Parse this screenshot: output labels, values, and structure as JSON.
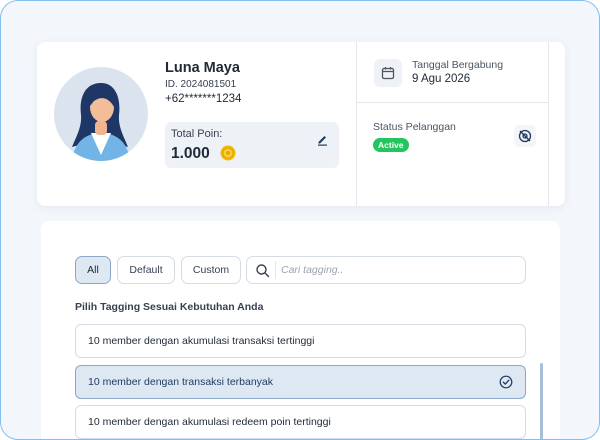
{
  "profile": {
    "name": "Luna Maya",
    "member_id": "ID. 2024081501",
    "phone": "+62*******1234",
    "points_label": "Total Poin:",
    "points_value": "1.000",
    "join_label": "Tanggal Bergabung",
    "join_date": "9 Agu 2026",
    "status_label": "Status Pelanggan",
    "status_badge": "Active"
  },
  "tagging": {
    "filters": [
      "All",
      "Default",
      "Custom"
    ],
    "active_filter": "All",
    "search_placeholder": "Cari tagging..",
    "section_title": "Pilih Tagging Sesuai Kebutuhan Anda",
    "items": [
      {
        "label": "10 member dengan akumulasi transaksi tertinggi",
        "selected": false
      },
      {
        "label": "10 member dengan transaksi terbanyak",
        "selected": true
      },
      {
        "label": "10 member dengan akumulasi redeem poin tertinggi",
        "selected": false
      }
    ]
  },
  "colors": {
    "accent": "#1e3a5f",
    "status_active": "#22c55e",
    "selected_bg": "#dde8f3",
    "coin": "#f5b800"
  },
  "icons": [
    "edit-icon",
    "coin-icon",
    "calendar-icon",
    "hidden-eye-icon",
    "search-icon",
    "check-circle-icon"
  ]
}
